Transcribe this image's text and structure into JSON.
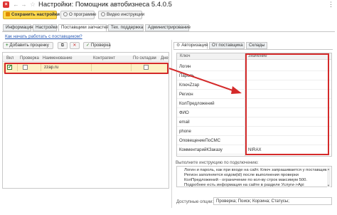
{
  "window": {
    "title": "Настройки: Помощник автобизнеса 5.4.0.5"
  },
  "toolbar": {
    "save_label": "Сохранить настройки",
    "about_label": "О программе",
    "video_label": "Видео инструкции"
  },
  "tabs": [
    {
      "label": "Информация",
      "active": false
    },
    {
      "label": "Настройки",
      "active": false
    },
    {
      "label": "Поставщики запчастей",
      "active": true
    },
    {
      "label": "Тех. поддержка",
      "active": false
    },
    {
      "label": "Администрирование",
      "active": false
    }
  ],
  "help_link": "Как начать работать с поставщиком?",
  "suppliers": {
    "add_label": "Добавить проценку",
    "check_label": "Проверка",
    "columns": [
      "Вкл",
      "Проверка",
      "Наименование",
      "Контрагент",
      "По складам",
      "Дне"
    ],
    "rows": [
      {
        "enabled": true,
        "check": false,
        "name": "zzap.ru",
        "counterparty": "",
        "by_warehouse": false
      }
    ]
  },
  "settings_tabs": [
    {
      "label": "Авторизация",
      "active": true
    },
    {
      "label": "От поставщика",
      "active": false
    },
    {
      "label": "Склады",
      "active": false
    }
  ],
  "auth_table": {
    "key_header": "Ключ",
    "value_header": "Значение",
    "rows": [
      {
        "key": "Логин",
        "value": ""
      },
      {
        "key": "Пароль",
        "value": ""
      },
      {
        "key": "КлючZzap",
        "value": ""
      },
      {
        "key": "Регион",
        "value": ""
      },
      {
        "key": "КолПредложений",
        "value": ""
      },
      {
        "key": "ФИО",
        "value": ""
      },
      {
        "key": "email",
        "value": ""
      },
      {
        "key": "phone",
        "value": ""
      },
      {
        "key": "ОповещениеПоСМС",
        "value": ""
      },
      {
        "key": "КомментарийКЗаказу",
        "value": "NIRAX"
      }
    ]
  },
  "instructions": {
    "label": "Выполните инструкцию по подключению:",
    "lines": [
      "Логин и пароль, как при входе на сайт. Ключ запрашивается у поставщика.",
      "Регион заполняется кодом(id) после выполнения проверки",
      "КолПредложений - ограничение по кол-ву строк максимум 500.",
      "Подробнее есть информация на сайте в разделе Услуги->Api"
    ]
  },
  "options": {
    "label": "Доступные опции:",
    "value": "Проверка; Поиск; Корзина; Статусы;"
  },
  "colors": {
    "accent_yellow": "#ffd84a",
    "annotation_red": "#d42a2a",
    "selected_row": "#fdf1c4"
  }
}
